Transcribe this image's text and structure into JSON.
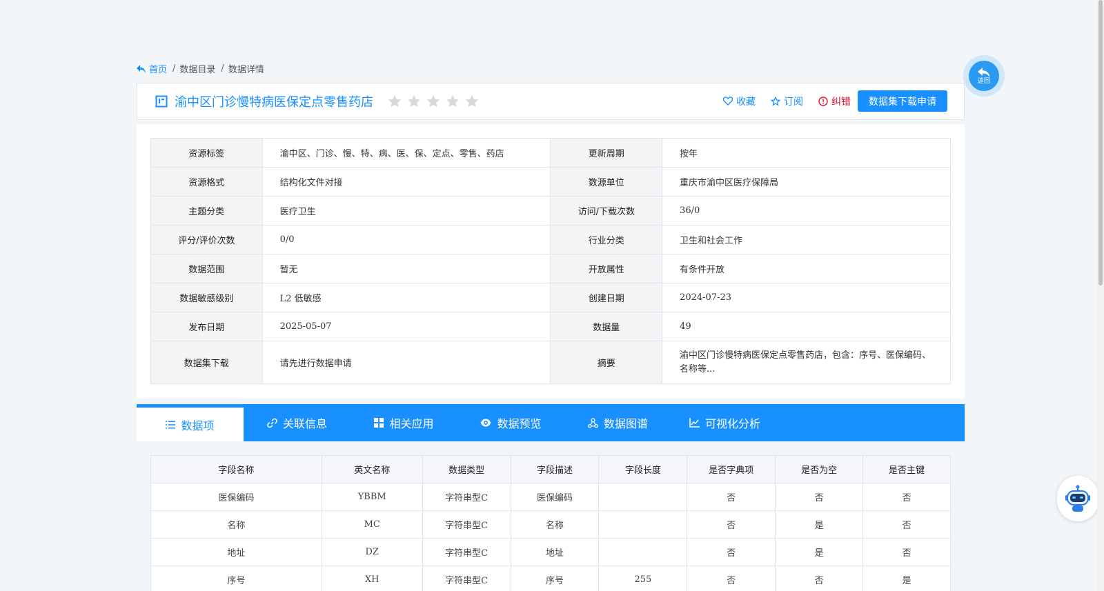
{
  "breadcrumb": {
    "home": "首页",
    "sep": "/",
    "items": [
      "数据目录",
      "数据详情"
    ]
  },
  "back_button": {
    "label": "返回"
  },
  "dataset": {
    "title": "渝中区门诊慢特病医保定点零售药店",
    "rating_stars": 0,
    "max_stars": 5
  },
  "actions": {
    "favorite": "收藏",
    "subscribe": "订阅",
    "report": "纠错",
    "apply": "数据集下载申请"
  },
  "info": {
    "rows": [
      {
        "k1": "资源标签",
        "v1": "渝中区、门诊、慢、特、病、医、保、定点、零售、药店",
        "k2": "更新周期",
        "v2": "按年"
      },
      {
        "k1": "资源格式",
        "v1": "结构化文件对接",
        "k2": "数源单位",
        "v2": "重庆市渝中区医疗保障局"
      },
      {
        "k1": "主题分类",
        "v1": "医疗卫生",
        "k2": "访问/下载次数",
        "v2": "36/0"
      },
      {
        "k1": "评分/评价次数",
        "v1": "0/0",
        "k2": "行业分类",
        "v2": "卫生和社会工作"
      },
      {
        "k1": "数据范围",
        "v1": "暂无",
        "k2": "开放属性",
        "v2": "有条件开放"
      },
      {
        "k1": "数据敏感级别",
        "v1": "L2 低敏感",
        "k2": "创建日期",
        "v2": "2024-07-23"
      },
      {
        "k1": "发布日期",
        "v1": "2025-05-07",
        "k2": "数据量",
        "v2": "49"
      },
      {
        "k1": "数据集下载",
        "v1": "请先进行数据申请",
        "k2": "摘要",
        "v2": "渝中区门诊慢特病医保定点零售药店，包含：序号、医保编码、名称等..."
      }
    ]
  },
  "tabs": [
    {
      "label": "数据项",
      "icon": "list-icon",
      "active": true
    },
    {
      "label": "关联信息",
      "icon": "link-icon",
      "active": false
    },
    {
      "label": "相关应用",
      "icon": "grid-icon",
      "active": false
    },
    {
      "label": "数据预览",
      "icon": "eye-icon",
      "active": false
    },
    {
      "label": "数据图谱",
      "icon": "graph-icon",
      "active": false
    },
    {
      "label": "可视化分析",
      "icon": "line-chart-icon",
      "active": false
    }
  ],
  "fields_table": {
    "headers": [
      "字段名称",
      "英文名称",
      "数据类型",
      "字段描述",
      "字段长度",
      "是否字典项",
      "是否为空",
      "是否主键"
    ],
    "rows": [
      [
        "医保编码",
        "YBBM",
        "字符串型C",
        "医保编码",
        "",
        "否",
        "否",
        "否"
      ],
      [
        "名称",
        "MC",
        "字符串型C",
        "名称",
        "",
        "否",
        "是",
        "否"
      ],
      [
        "地址",
        "DZ",
        "字符串型C",
        "地址",
        "",
        "否",
        "是",
        "否"
      ],
      [
        "序号",
        "XH",
        "字符串型C",
        "序号",
        "255",
        "否",
        "否",
        "是"
      ]
    ]
  },
  "colors": {
    "primary": "#1890ff",
    "error": "#e0102f",
    "star_empty": "#d8d8d8"
  }
}
